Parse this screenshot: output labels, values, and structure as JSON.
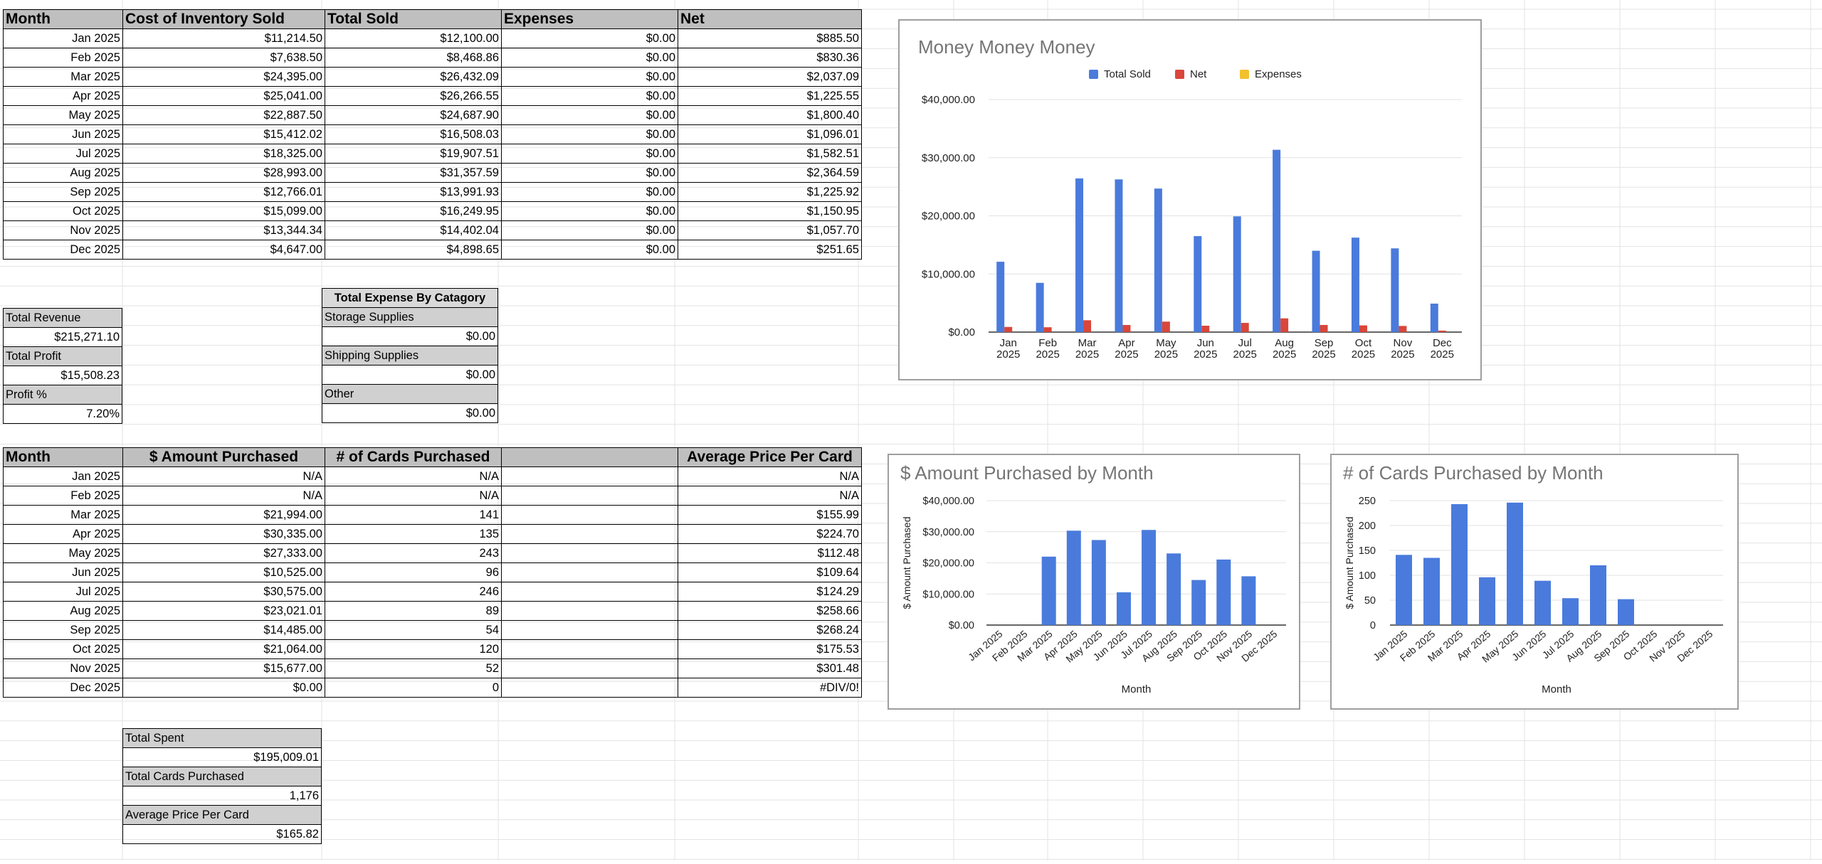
{
  "sales_table": {
    "headers": [
      "Month",
      "Cost of Inventory Sold",
      "Total Sold",
      "Expenses",
      "Net"
    ],
    "rows": [
      [
        "Jan 2025",
        "$11,214.50",
        "$12,100.00",
        "$0.00",
        "$885.50"
      ],
      [
        "Feb 2025",
        "$7,638.50",
        "$8,468.86",
        "$0.00",
        "$830.36"
      ],
      [
        "Mar 2025",
        "$24,395.00",
        "$26,432.09",
        "$0.00",
        "$2,037.09"
      ],
      [
        "Apr 2025",
        "$25,041.00",
        "$26,266.55",
        "$0.00",
        "$1,225.55"
      ],
      [
        "May 2025",
        "$22,887.50",
        "$24,687.90",
        "$0.00",
        "$1,800.40"
      ],
      [
        "Jun 2025",
        "$15,412.02",
        "$16,508.03",
        "$0.00",
        "$1,096.01"
      ],
      [
        "Jul 2025",
        "$18,325.00",
        "$19,907.51",
        "$0.00",
        "$1,582.51"
      ],
      [
        "Aug 2025",
        "$28,993.00",
        "$31,357.59",
        "$0.00",
        "$2,364.59"
      ],
      [
        "Sep 2025",
        "$12,766.01",
        "$13,991.93",
        "$0.00",
        "$1,225.92"
      ],
      [
        "Oct 2025",
        "$15,099.00",
        "$16,249.95",
        "$0.00",
        "$1,150.95"
      ],
      [
        "Nov 2025",
        "$13,344.34",
        "$14,402.04",
        "$0.00",
        "$1,057.70"
      ],
      [
        "Dec 2025",
        "$4,647.00",
        "$4,898.65",
        "$0.00",
        "$251.65"
      ]
    ]
  },
  "revenue_summary": {
    "total_revenue_label": "Total Revenue",
    "total_revenue": "$215,271.10",
    "total_profit_label": "Total Profit",
    "total_profit": "$15,508.23",
    "profit_pct_label": "Profit %",
    "profit_pct": "7.20%"
  },
  "expense_table": {
    "title": "Total Expense By Catagory",
    "items": [
      {
        "label": "Storage Supplies",
        "value": "$0.00"
      },
      {
        "label": "Shipping Supplies",
        "value": "$0.00"
      },
      {
        "label": "Other",
        "value": "$0.00"
      }
    ]
  },
  "purchase_table": {
    "headers": [
      "Month",
      "$ Amount Purchased",
      "# of Cards Purchased",
      "",
      "Average Price Per Card"
    ],
    "rows": [
      [
        "Jan 2025",
        "N/A",
        "N/A",
        "",
        "N/A"
      ],
      [
        "Feb 2025",
        "N/A",
        "N/A",
        "",
        "N/A"
      ],
      [
        "Mar 2025",
        "$21,994.00",
        "141",
        "",
        "$155.99"
      ],
      [
        "Apr 2025",
        "$30,335.00",
        "135",
        "",
        "$224.70"
      ],
      [
        "May 2025",
        "$27,333.00",
        "243",
        "",
        "$112.48"
      ],
      [
        "Jun 2025",
        "$10,525.00",
        "96",
        "",
        "$109.64"
      ],
      [
        "Jul 2025",
        "$30,575.00",
        "246",
        "",
        "$124.29"
      ],
      [
        "Aug 2025",
        "$23,021.01",
        "89",
        "",
        "$258.66"
      ],
      [
        "Sep 2025",
        "$14,485.00",
        "54",
        "",
        "$268.24"
      ],
      [
        "Oct 2025",
        "$21,064.00",
        "120",
        "",
        "$175.53"
      ],
      [
        "Nov 2025",
        "$15,677.00",
        "52",
        "",
        "$301.48"
      ],
      [
        "Dec 2025",
        "$0.00",
        "0",
        "",
        "#DIV/0!"
      ]
    ]
  },
  "purchase_summary": {
    "total_spent_label": "Total Spent",
    "total_spent": "$195,009.01",
    "total_cards_label": "Total Cards Purchased",
    "total_cards": "1,176",
    "avg_price_label": "Average Price Per Card",
    "avg_price": "$165.82"
  },
  "colors": {
    "blue": "#4a7bdc",
    "red": "#d9463a",
    "yellow": "#f2c12e",
    "grid": "#e2e2e2",
    "title": "#757575",
    "header_bg": "#bfbfbf"
  },
  "chart_data": [
    {
      "type": "bar",
      "title": "Money Money Money",
      "categories": [
        "Jan 2025",
        "Feb 2025",
        "Mar 2025",
        "Apr 2025",
        "May 2025",
        "Jun 2025",
        "Jul 2025",
        "Aug 2025",
        "Sep 2025",
        "Oct 2025",
        "Nov 2025",
        "Dec 2025"
      ],
      "series": [
        {
          "name": "Total Sold",
          "color": "#4a7bdc",
          "values": [
            12100.0,
            8468.86,
            26432.09,
            26266.55,
            24687.9,
            16508.03,
            19907.51,
            31357.59,
            13991.93,
            16249.95,
            14402.04,
            4898.65
          ]
        },
        {
          "name": "Net",
          "color": "#d9463a",
          "values": [
            885.5,
            830.36,
            2037.09,
            1225.55,
            1800.4,
            1096.01,
            1582.51,
            2364.59,
            1225.92,
            1150.95,
            1057.7,
            251.65
          ]
        },
        {
          "name": "Expenses",
          "color": "#f2c12e",
          "values": [
            0,
            0,
            0,
            0,
            0,
            0,
            0,
            0,
            0,
            0,
            0,
            0
          ]
        }
      ],
      "ylim": [
        0,
        40000
      ],
      "y_ticks": [
        "$0.00",
        "$10,000.00",
        "$20,000.00",
        "$30,000.00",
        "$40,000.00"
      ],
      "legend": "top",
      "grid": true,
      "xlabel": "",
      "ylabel": ""
    },
    {
      "type": "bar",
      "title": "$ Amount Purchased by Month",
      "categories": [
        "Jan 2025",
        "Feb 2025",
        "Mar 2025",
        "Apr 2025",
        "May 2025",
        "Jun 2025",
        "Jul 2025",
        "Aug 2025",
        "Sep 2025",
        "Oct 2025",
        "Nov 2025",
        "Dec 2025"
      ],
      "series": [
        {
          "color": "#4a7bdc",
          "values": [
            0,
            0,
            21994.0,
            30335.0,
            27333.0,
            10525.0,
            30575.0,
            23021.01,
            14485.0,
            21064.0,
            15677.0,
            0
          ]
        }
      ],
      "ylim": [
        0,
        40000
      ],
      "y_ticks": [
        "$0.00",
        "$10,000.00",
        "$20,000.00",
        "$30,000.00",
        "$40,000.00"
      ],
      "xlabel": "Month",
      "ylabel": "$ Amount Purchased",
      "grid": true
    },
    {
      "type": "bar",
      "title": "# of Cards Purchased by Month",
      "categories": [
        "Jan 2025",
        "Feb 2025",
        "Mar 2025",
        "Apr 2025",
        "May 2025",
        "Jun 2025",
        "Jul 2025",
        "Aug 2025",
        "Sep 2025",
        "Oct 2025",
        "Nov 2025",
        "Dec 2025"
      ],
      "series": [
        {
          "color": "#4a7bdc",
          "values": [
            141,
            135,
            243,
            96,
            246,
            89,
            54,
            120,
            52,
            0,
            0,
            0
          ]
        }
      ],
      "ylim": [
        0,
        250
      ],
      "y_ticks": [
        "0",
        "50",
        "100",
        "150",
        "200",
        "250"
      ],
      "xlabel": "Month",
      "ylabel": "$ Amount Purchased",
      "grid": true
    }
  ]
}
